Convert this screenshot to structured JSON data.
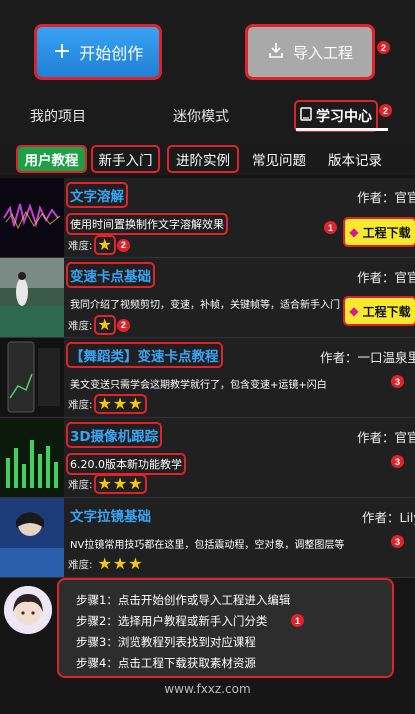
{
  "header": {
    "create_label": "开始创作",
    "import_label": "导入工程",
    "import_badge": "2"
  },
  "tabs": [
    {
      "label": "我的项目"
    },
    {
      "label": "迷你模式"
    },
    {
      "label": "学习中心",
      "badge": "2"
    }
  ],
  "subnav": [
    {
      "label": "用户教程"
    },
    {
      "label": "新手入门"
    },
    {
      "label": "进阶实例"
    },
    {
      "label": "常见问题"
    },
    {
      "label": "版本记录"
    }
  ],
  "courses": [
    {
      "title": "文字溶解",
      "author": "作者：官官",
      "desc": "使用时间置换制作文字溶解效果",
      "difficulty_label": "难度:",
      "stars": 1,
      "badge": "2",
      "side_badge": "1",
      "download_label": "工程下载"
    },
    {
      "title": "变速卡点基础",
      "author": "作者：官官",
      "desc": "我同介绍了视频剪切，变速，补帧，关键帧等，适合新手入门",
      "difficulty_label": "难度:",
      "stars": 1,
      "badge": "2",
      "download_label": "工程下载"
    },
    {
      "title_prefix": "【舞蹈类】",
      "title": "变速卡点教程",
      "author": "作者：一口温泉里",
      "desc": "美文变送只需学会这期教学就行了，包含变速+运镜+闪白",
      "difficulty_label": "难度:",
      "stars": 3,
      "side_badge": "3"
    },
    {
      "title": "3D摄像机跟踪",
      "author": "作者：官官",
      "desc": "6.20.0版本新功能教学",
      "difficulty_label": "难度:",
      "stars": 3,
      "side_badge": "3"
    },
    {
      "title": "文字拉镜基础",
      "author": "作者：Lily",
      "desc": "NV拉镜常用技巧都在这里，包括震动程，空对象，调整图层等",
      "difficulty_label": "难度:",
      "stars": 3,
      "side_badge": "3"
    }
  ],
  "tips": {
    "badge": "1",
    "steps": [
      "步骤1：点击开始创作或导入工程进入编辑",
      "步骤2：选择用户教程或新手入门分类",
      "步骤3：浏览教程列表找到对应课程",
      "步骤4：点击工程下载获取素材资源"
    ]
  },
  "footer": "www.fxxz.com",
  "colors": {
    "accent": "#3aa3f3",
    "highlight": "#e0232a",
    "active_tab": "#1ea049",
    "star": "#f5c518",
    "download": "#f7e830"
  }
}
